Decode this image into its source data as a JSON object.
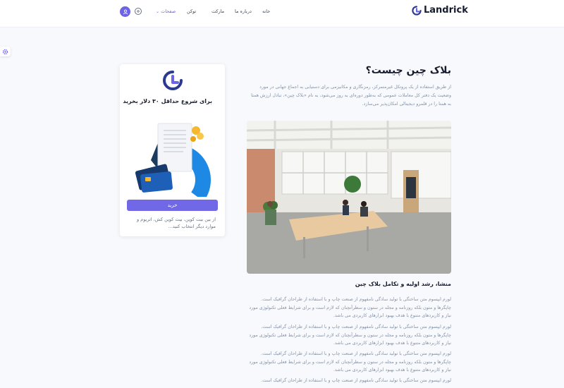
{
  "header": {
    "brand": "Landrick",
    "nav": [
      {
        "label": "خانه"
      },
      {
        "label": "درباره ما"
      },
      {
        "label": "مارکت"
      },
      {
        "label": "توکن"
      },
      {
        "label": "صفحات"
      }
    ]
  },
  "card": {
    "heading": "برای شروع حداقل ۳۰ دلار بخرید",
    "buy_label": "خرید",
    "description": "از بین بیت کوین، بیت کوین کش، اتریوم و موارد دیگر انتخاب کنید..."
  },
  "article": {
    "title": "بلاک چین چیست؟",
    "intro": "از طریق استفاده از یک پروتکل غیرمتمرکز، رمزنگاری و مکانیزمی برای دستیابی به اجماع جهانی در مورد وضعیت یک دفتر کل معاملات عمومی که به‌طور دوره‌ای به روز می‌شود، به نام «بلاک چین»، تبادل ارزش همتا به همتا را در قلمرو دیجیتالی امکان‌پذیر می‌سازد.",
    "section_title": "منشا، رشد اولیه و تکامل بلاک چین",
    "paragraphs": [
      "لورم ایپسوم متن ساختگی با تولید سادگی نامفهوم از صنعت چاپ و با استفاده از طراحان گرافیک است. چاپگرها و متون بلکه روزنامه و مجله در ستون و سطرآنچنان که لازم است و برای شرایط فعلی تکنولوژی مورد نیاز و کاربردهای متنوع با هدف بهبود ابزارهای کاربردی می باشد.",
      "لورم ایپسوم متن ساختگی با تولید سادگی نامفهوم از صنعت چاپ و با استفاده از طراحان گرافیک است. چاپگرها و متون بلکه روزنامه و مجله در ستون و سطرآنچنان که لازم است و برای شرایط فعلی تکنولوژی مورد نیاز و کاربردهای متنوع با هدف بهبود ابزارهای کاربردی می باشد.",
      "لورم ایپسوم متن ساختگی با تولید سادگی نامفهوم از صنعت چاپ و با استفاده از طراحان گرافیک است. چاپگرها و متون بلکه روزنامه و مجله در ستون و سطرآنچنان که لازم است و برای شرایط فعلی تکنولوژی مورد نیاز و کاربردهای متنوع با هدف بهبود ابزارهای کاربردی می باشد.",
      "لورم ایپسوم متن ساختگی با تولید سادگی نامفهوم از صنعت چاپ و با استفاده از طراحان گرافیک است."
    ]
  },
  "icons": {
    "user": "user-icon",
    "settings": "settings-icon",
    "side_gear": "gear-icon",
    "dropdown": "chevron-down-icon"
  },
  "colors": {
    "accent": "#6d63e6",
    "heading": "#161c2d",
    "muted": "#8492a6"
  }
}
